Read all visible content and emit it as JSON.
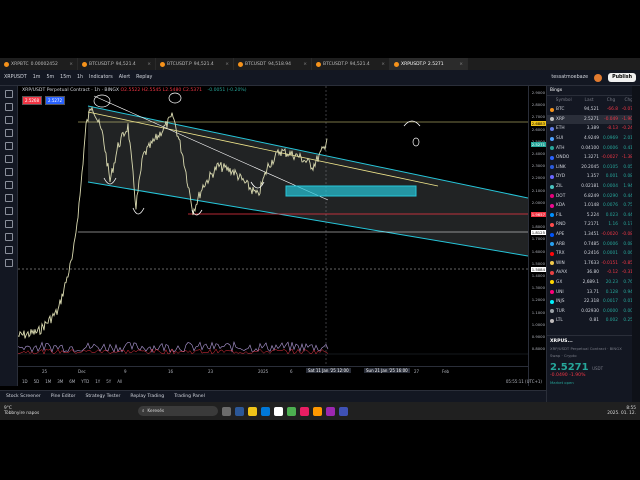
{
  "browser_tabs": [
    {
      "label": "XRPBTC",
      "value": "0.00002452",
      "active": false
    },
    {
      "label": "BTCUSDT.P",
      "value": "94,521.4",
      "active": false
    },
    {
      "label": "BTCUSDT.P",
      "value": "94,521.4",
      "active": false
    },
    {
      "label": "BTCUSDT",
      "value": "94,518.94",
      "active": false
    },
    {
      "label": "BTCUSDT.P",
      "value": "94,521.4",
      "active": false
    },
    {
      "label": "XRPUSDT.P",
      "value": "2.5271",
      "active": true
    }
  ],
  "toolbar": {
    "symbol": "XRPUSDT",
    "intervals": [
      "1m",
      "5m",
      "15m",
      "1h"
    ],
    "indicators": "Indicators",
    "alert": "Alert",
    "replay": "Replay",
    "layout_name": "tessatmoebaze",
    "publish": "Publish"
  },
  "chart": {
    "legend_title": "XRP/USDT Perpetual Contract · 1h · BINGX",
    "ohlc": "O2.5522 H2.5545 L2.5480 C2.5371",
    "change": "-0.0051 (-0.20%)",
    "sell_price": "2.5268",
    "buy_price": "2.5272",
    "price_ticks": [
      "2.9000",
      "2.8000",
      "2.7000",
      "2.6000",
      "2.5000",
      "2.4000",
      "2.3000",
      "2.2000",
      "2.1000",
      "2.0000",
      "1.9000",
      "1.8000",
      "1.7000",
      "1.6000",
      "1.5000",
      "1.4000",
      "1.3000",
      "1.2000",
      "1.1000",
      "1.0000",
      "0.9000",
      "0.8000"
    ],
    "last_price_tag": "2.5271",
    "level_tag_1": "2.6883",
    "level_tag_2": "1.9657",
    "level_tag_3": "1.8125",
    "level_tag_4": "1.5084",
    "time_ticks": [
      "25",
      "Dec",
      "9",
      "16",
      "23",
      "2025",
      "6",
      "13",
      "20",
      "27",
      "Feb"
    ],
    "crosshair_time": "Sat 11 Jan '25 12:00",
    "crosshair_time_2": "Sun 21 Jan '25 16:00",
    "clock": "05:55:11 (UTC+1)",
    "ranges": [
      "1D",
      "5D",
      "1M",
      "3M",
      "6M",
      "YTD",
      "1Y",
      "5Y",
      "All"
    ]
  },
  "bottom_tabs": [
    "Stock Screener",
    "Pine Editor",
    "Strategy Tester",
    "Replay Trading",
    "Trading Panel"
  ],
  "watchlist": {
    "title": "Bingx",
    "columns": [
      "Symbol",
      "Last",
      "Chg",
      "Chg%"
    ],
    "rows": [
      {
        "sym": "BTC",
        "last": "94,521",
        "chg": "-66.8",
        "pct": "-0.07%",
        "dir": "dn",
        "color": "#f7931a"
      },
      {
        "sym": "XRP",
        "last": "2.5271",
        "chg": "-0.049",
        "pct": "-1.90%",
        "dir": "dn",
        "color": "#c0c0c0"
      },
      {
        "sym": "ETH",
        "last": "3,389",
        "chg": "-8.13",
        "pct": "-0.24%",
        "dir": "dn",
        "color": "#627eea"
      },
      {
        "sym": "SUI",
        "last": "4.9249",
        "chg": "0.0969",
        "pct": "2.01%",
        "dir": "up",
        "color": "#4da2ff"
      },
      {
        "sym": "ATH",
        "last": "0.04100",
        "chg": "0.0006",
        "pct": "0.41%",
        "dir": "up",
        "color": "#26a69a"
      },
      {
        "sym": "ONDO",
        "last": "1.3271",
        "chg": "-0.0027",
        "pct": "-1.38%",
        "dir": "dn",
        "color": "#2962ff"
      },
      {
        "sym": "LINK",
        "last": "20.2045",
        "chg": "0.0105",
        "pct": "0.05%",
        "dir": "up",
        "color": "#2a5ada"
      },
      {
        "sym": "DYD",
        "last": "1.357",
        "chg": "0.001",
        "pct": "0.08%",
        "dir": "up",
        "color": "#6966ff"
      },
      {
        "sym": "ZIL",
        "last": "0.02181",
        "chg": "0.0004",
        "pct": "1.94%",
        "dir": "up",
        "color": "#49c1bf"
      },
      {
        "sym": "DOT",
        "last": "6.8249",
        "chg": "0.0290",
        "pct": "0.44%",
        "dir": "up",
        "color": "#e6007a"
      },
      {
        "sym": "KDA",
        "last": "1.0148",
        "chg": "0.0076",
        "pct": "0.75%",
        "dir": "up",
        "color": "#ed098f"
      },
      {
        "sym": "FIL",
        "last": "5.224",
        "chg": "0.023",
        "pct": "0.44%",
        "dir": "up",
        "color": "#0090ff"
      },
      {
        "sym": "RND",
        "last": "7.2171",
        "chg": "1.16",
        "pct": "0.17%",
        "dir": "up",
        "color": "#ff4c4c"
      },
      {
        "sym": "APE",
        "last": "1.3451",
        "chg": "-0.0020",
        "pct": "-0.08%",
        "dir": "dn",
        "color": "#0054f9"
      },
      {
        "sym": "ARB",
        "last": "0.7485",
        "chg": "0.0006",
        "pct": "0.08%",
        "dir": "up",
        "color": "#28a0f0"
      },
      {
        "sym": "TRX",
        "last": "0.2416",
        "chg": "0.0001",
        "pct": "0.06%",
        "dir": "up",
        "color": "#ff060a"
      },
      {
        "sym": "WIN",
        "last": "1.7633",
        "chg": "-0.0151",
        "pct": "-0.85%",
        "dir": "dn",
        "color": "#f2c94c"
      },
      {
        "sym": "AVAX",
        "last": "36.80",
        "chg": "-0.12",
        "pct": "-0.31%",
        "dir": "dn",
        "color": "#e84142"
      },
      {
        "sym": "GX",
        "last": "2,689.1",
        "chg": "20.23",
        "pct": "0.76%",
        "dir": "up",
        "color": "#ffd700"
      },
      {
        "sym": "UNI",
        "last": "13.71",
        "chg": "0.128",
        "pct": "0.94%",
        "dir": "up",
        "color": "#ff007a"
      },
      {
        "sym": "INJS",
        "last": "22.318",
        "chg": "0.0017",
        "pct": "0.01%",
        "dir": "up",
        "color": "#00f2fe"
      },
      {
        "sym": "TUR",
        "last": "0.02930",
        "chg": "0.0000",
        "pct": "0.00%",
        "dir": "up",
        "color": "#9aa0a6"
      },
      {
        "sym": "LTL",
        "last": "0.81",
        "chg": "0.002",
        "pct": "0.25%",
        "dir": "up",
        "color": "#bfbbbb"
      }
    ]
  },
  "detail": {
    "name": "XRPUS...",
    "desc": "XRP/USDT Perpetual Contract · BINGX",
    "category": "Swap · Crypto",
    "price": "2.5271",
    "currency": "USDT",
    "change": "-0.0490  -1.90%",
    "market": "Market open"
  },
  "taskbar": {
    "weather_temp": "9°C",
    "weather_desc": "Többnyire napos",
    "search": "Keresés",
    "time": "8:55",
    "date": "2025. 01. 12."
  }
}
